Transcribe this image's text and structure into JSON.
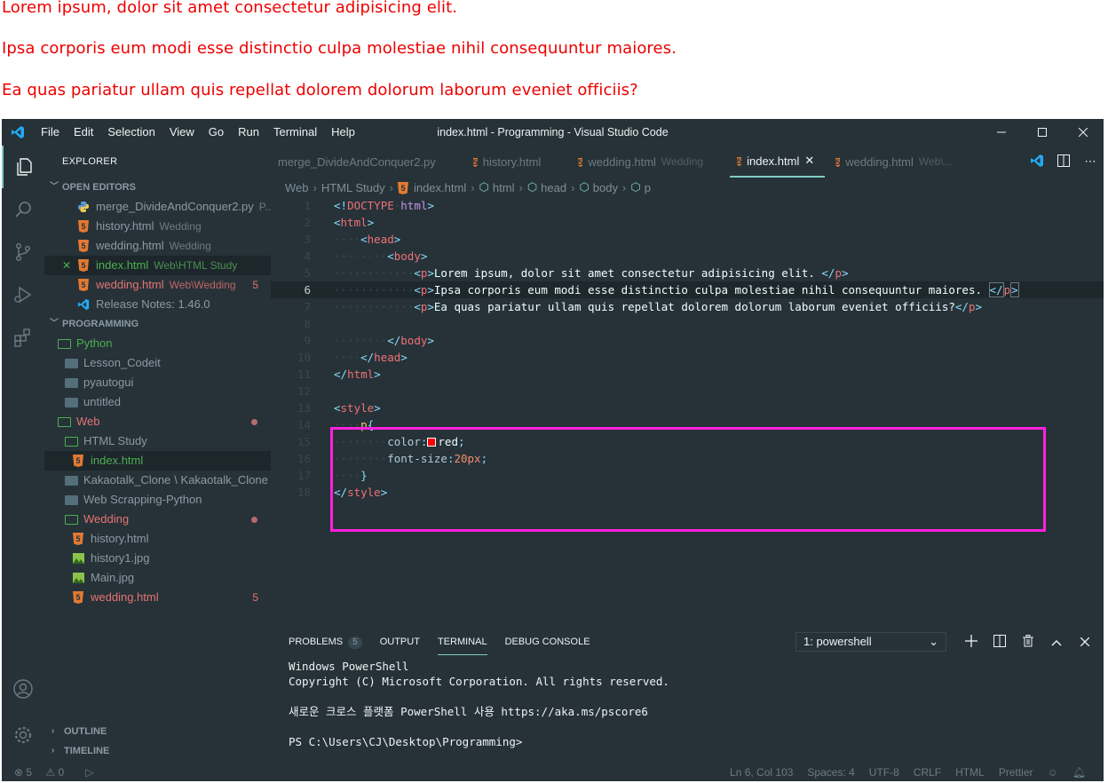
{
  "webpage": {
    "lines": [
      "Lorem ipsum, dolor sit amet consectetur adipisicing elit.",
      "Ipsa corporis eum modi esse distinctio culpa molestiae nihil consequuntur maiores.",
      "Ea quas pariatur ullam quis repellat dolorem dolorum laborum eveniet officiis?"
    ],
    "color": "#ee0000"
  },
  "window": {
    "title": "index.html - Programming - Visual Studio Code",
    "menu": [
      "File",
      "Edit",
      "Selection",
      "View",
      "Go",
      "Run",
      "Terminal",
      "Help"
    ]
  },
  "sidebar": {
    "title": "EXPLORER",
    "open_editors_label": "OPEN EDITORS",
    "open_editors": [
      {
        "name": "merge_DivideAndConquer2.py",
        "desc": "P...",
        "icon": "python-icon"
      },
      {
        "name": "history.html",
        "desc": "Wedding",
        "icon": "html5-icon"
      },
      {
        "name": "wedding.html",
        "desc": "Wedding",
        "icon": "html5-icon"
      },
      {
        "name": "index.html",
        "desc": "Web\\HTML Study",
        "icon": "html5-icon"
      },
      {
        "name": "wedding.html",
        "desc": "Web\\Wedding",
        "icon": "html5-icon",
        "badge": "5"
      },
      {
        "name": "Release Notes: 1.46.0",
        "desc": "",
        "icon": "vscode-icon"
      }
    ],
    "workspace_label": "PROGRAMMING",
    "tree": [
      {
        "name": "Python",
        "desc": ""
      },
      {
        "name": "Lesson_Codeit",
        "desc": ""
      },
      {
        "name": "pyautogui",
        "desc": ""
      },
      {
        "name": "untitled",
        "desc": ""
      },
      {
        "name": "Web",
        "desc": ""
      },
      {
        "name": "HTML Study",
        "desc": ""
      },
      {
        "name": "index.html",
        "desc": ""
      },
      {
        "name": "Kakaotalk_Clone",
        "desc": "\\ Kakaotalk_Clone"
      },
      {
        "name": "Web Scrapping-Python",
        "desc": ""
      },
      {
        "name": "Wedding",
        "desc": ""
      },
      {
        "name": "history.html",
        "desc": ""
      },
      {
        "name": "history1.jpg",
        "desc": ""
      },
      {
        "name": "Main.jpg",
        "desc": ""
      },
      {
        "name": "wedding.html",
        "desc": "",
        "badge": "5"
      }
    ],
    "outline_label": "OUTLINE",
    "timeline_label": "TIMELINE"
  },
  "tabs": [
    {
      "name": "merge_DivideAndConquer2.py",
      "desc": ""
    },
    {
      "name": "history.html",
      "desc": ""
    },
    {
      "name": "wedding.html",
      "desc": "Wedding"
    },
    {
      "name": "index.html",
      "desc": "",
      "close": "✕"
    },
    {
      "name": "wedding.html",
      "desc": "Web\\..."
    }
  ],
  "breadcrumb": [
    "Web",
    "HTML Study",
    "index.html",
    "html",
    "head",
    "body",
    "p"
  ],
  "code_lines": [
    {
      "n": "1"
    },
    {
      "n": "2"
    },
    {
      "n": "3"
    },
    {
      "n": "4"
    },
    {
      "n": "5"
    },
    {
      "n": "6"
    },
    {
      "n": "7"
    },
    {
      "n": "8"
    },
    {
      "n": "9"
    },
    {
      "n": "10"
    },
    {
      "n": "11"
    },
    {
      "n": "12"
    },
    {
      "n": "13"
    },
    {
      "n": "14"
    },
    {
      "n": "15"
    },
    {
      "n": "16"
    },
    {
      "n": "17"
    },
    {
      "n": "18"
    }
  ],
  "code": {
    "doctype": "DOCTYPE",
    "html_kw": "html",
    "tag_html": "html",
    "tag_head": "head",
    "tag_body": "body",
    "tag_p": "p",
    "tag_style": "style",
    "p1": "Lorem ipsum, dolor sit amet consectetur adipisicing elit. ",
    "p2": "Ipsa corporis eum modi esse distinctio culpa molestiae nihil consequuntur maiores. ",
    "p3": "Ea quas pariatur ullam quis repellat dolorem dolorum laborum eveniet officiis?",
    "selector": "p",
    "prop_color": "color",
    "val_color": "red",
    "prop_size": "font-size",
    "val_size": "20px"
  },
  "panel": {
    "tabs": [
      "PROBLEMS",
      "OUTPUT",
      "TERMINAL",
      "DEBUG CONSOLE"
    ],
    "problems_count": "5",
    "terminal_select": "1: powershell",
    "terminal_text": "Windows PowerShell\nCopyright (C) Microsoft Corporation. All rights reserved.\n\n새로운 크로스 플랫폼 PowerShell 사용 https://aka.ms/pscore6\n\nPS C:\\Users\\CJ\\Desktop\\Programming>"
  },
  "status": {
    "errors": "5",
    "warnings": "0",
    "position": "Ln 6, Col 103",
    "spaces": "Spaces: 4",
    "encoding": "UTF-8",
    "eol": "CRLF",
    "language": "HTML",
    "formatter": "Prettier"
  },
  "colors": {
    "editor_bg": "#263238",
    "accent": "#80cbc4",
    "git_added": "#4caf50",
    "error": "#e57373",
    "highlight_box": "#ff22dd"
  }
}
